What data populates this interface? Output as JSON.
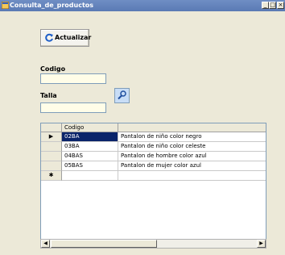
{
  "window": {
    "title": "Consulta_de_productos",
    "controls": {
      "minimize": "_",
      "maximize": "□",
      "close": "×"
    }
  },
  "toolbar": {
    "refresh_label": "Actualizar"
  },
  "form": {
    "codigo_label": "Codigo",
    "codigo_value": "",
    "talla_label": "Talla",
    "talla_value": ""
  },
  "grid": {
    "columns": [
      "Codigo",
      ""
    ],
    "current_row_marker": "▶",
    "new_row_marker": "✱",
    "rows": [
      {
        "codigo": "02BA",
        "descripcion": "Pantalon de niño color negro"
      },
      {
        "codigo": "03BA",
        "descripcion": "Pantalon de niño color celeste"
      },
      {
        "codigo": "04BAS",
        "descripcion": "Pantalon de hombre color azul"
      },
      {
        "codigo": "05BAS",
        "descripcion": "Pantalon de mujer color azul"
      }
    ]
  },
  "scrollbar": {
    "left_arrow": "◀",
    "right_arrow": "▶"
  },
  "icons": {
    "app": "form-icon",
    "refresh": "refresh-icon",
    "search": "search-icon"
  }
}
